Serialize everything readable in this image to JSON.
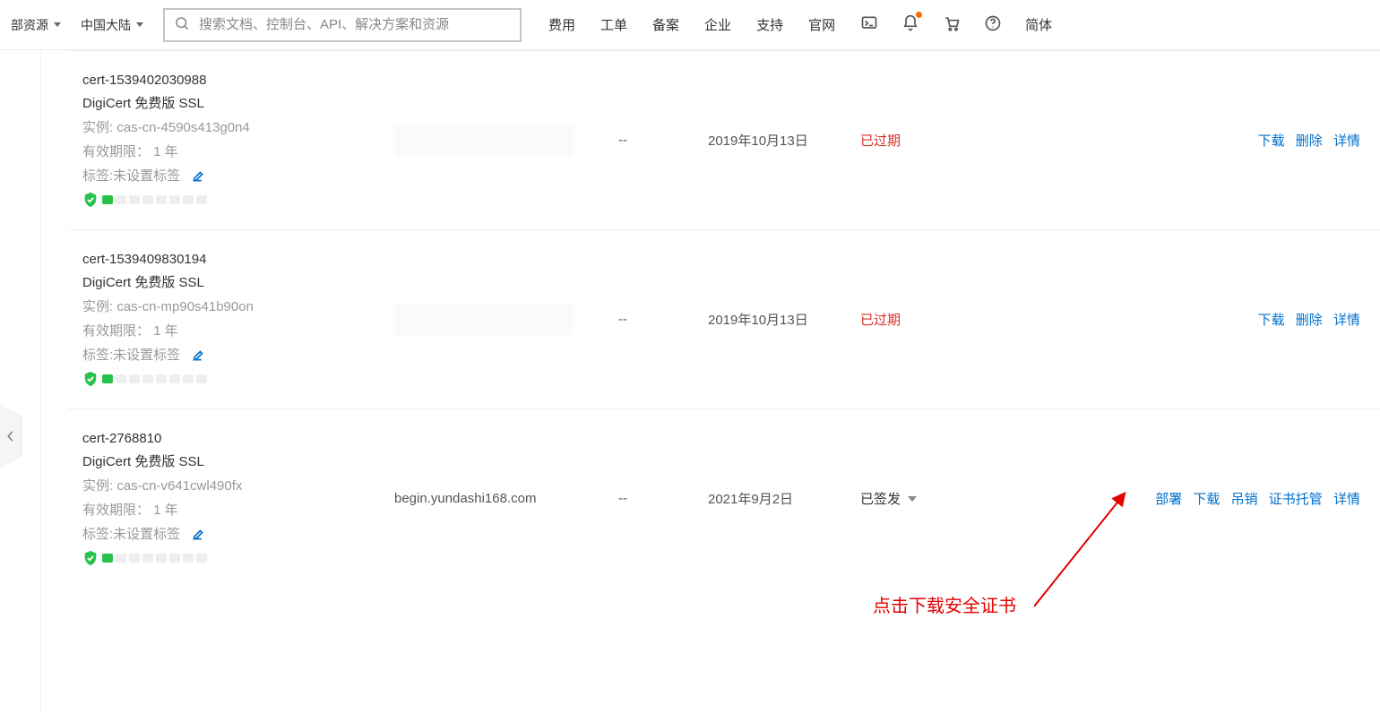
{
  "header": {
    "resources_label": "部资源",
    "region_label": "中国大陆",
    "search_placeholder": "搜索文档、控制台、API、解决方案和资源",
    "nav": [
      "费用",
      "工单",
      "备案",
      "企业",
      "支持",
      "官网"
    ],
    "lang": "简体"
  },
  "status_expired_label": "已过期",
  "status_issued_label": "已签发",
  "labels": {
    "instance_prefix": "实例: ",
    "validity_prefix": "有效期限： ",
    "tags_prefix": "标签:",
    "tags_not_set": "未设置标签"
  },
  "actions": {
    "download": "下载",
    "delete": "删除",
    "detail": "详情",
    "deploy": "部署",
    "revoke": "吊销",
    "managed": "证书托管"
  },
  "rows": [
    {
      "name": "cert-1539402030988",
      "subtitle": "DigiCert 免费版 SSL",
      "instance": "cas-cn-4590s413g0n4",
      "validity": "1 年",
      "domain_hidden": true,
      "domain": "",
      "dash": "--",
      "date": "2019年10月13日",
      "status": "expired",
      "action_set": "a"
    },
    {
      "name": "cert-1539409830194",
      "subtitle": "DigiCert 免费版 SSL",
      "instance": "cas-cn-mp90s41b90on",
      "validity": "1 年",
      "domain_hidden": true,
      "domain": "",
      "dash": "--",
      "date": "2019年10月13日",
      "status": "expired",
      "action_set": "a"
    },
    {
      "name": "cert-2768810",
      "subtitle": "DigiCert 免费版 SSL",
      "instance": "cas-cn-v641cwl490fx",
      "validity": "1 年",
      "domain_hidden": false,
      "domain": "begin.yundashi168.com",
      "dash": "--",
      "date": "2021年9月2日",
      "status": "issued",
      "action_set": "b"
    }
  ],
  "annotation": "点击下载安全证书"
}
